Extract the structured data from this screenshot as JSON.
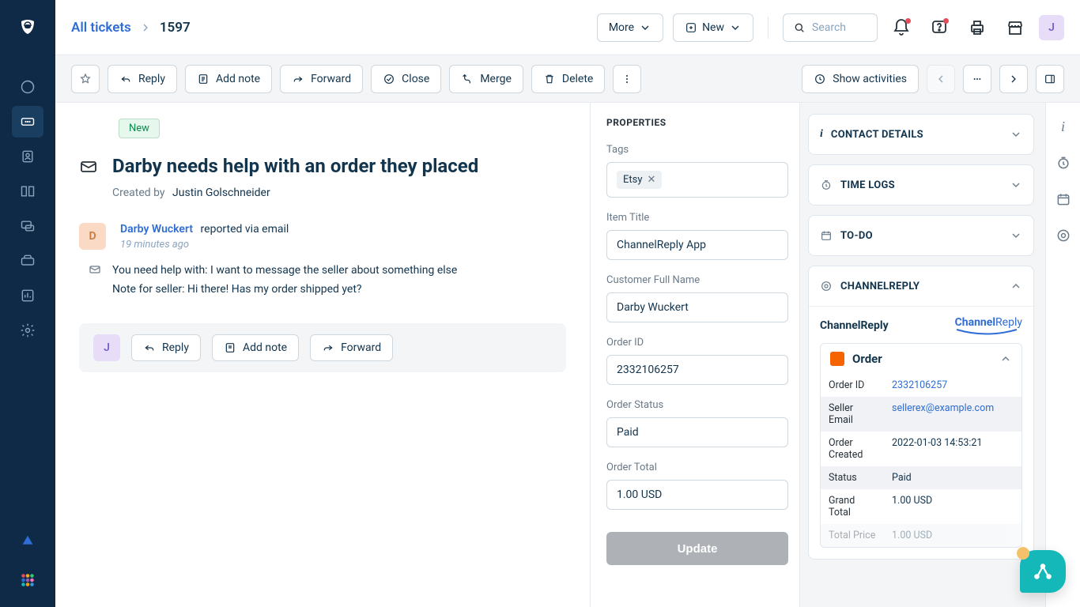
{
  "breadcrumb": {
    "link": "All tickets",
    "current": "1597"
  },
  "topbar": {
    "more": "More",
    "new": "New",
    "search_placeholder": "Search",
    "avatar_initial": "J"
  },
  "actions": {
    "reply": "Reply",
    "add_note": "Add note",
    "forward": "Forward",
    "close": "Close",
    "merge": "Merge",
    "delete": "Delete",
    "show_activities": "Show activities"
  },
  "ticket": {
    "status": "New",
    "title": "Darby needs help with an order they placed",
    "created_by_label": "Created by",
    "created_by_name": "Justin Golschneider",
    "reporter": {
      "initial": "D",
      "name": "Darby Wuckert",
      "via": "reported via email",
      "time": "19 minutes ago"
    },
    "body_line1": "You need help with: I want to message the seller about something else",
    "body_line2": "Note for seller: Hi there! Has my order shipped yet?"
  },
  "replybox": {
    "avatar_initial": "J",
    "reply": "Reply",
    "add_note": "Add note",
    "forward": "Forward"
  },
  "properties": {
    "panel_title": "PROPERTIES",
    "tags_label": "Tags",
    "tags": [
      "Etsy"
    ],
    "fields": {
      "item_title": {
        "label": "Item Title",
        "value": "ChannelReply App"
      },
      "customer_name": {
        "label": "Customer Full Name",
        "value": "Darby Wuckert"
      },
      "order_id": {
        "label": "Order ID",
        "value": "2332106257"
      },
      "order_status": {
        "label": "Order Status",
        "value": "Paid"
      },
      "order_total": {
        "label": "Order Total",
        "value": "1.00 USD"
      }
    },
    "update": "Update"
  },
  "right_panels": {
    "contact_details": "CONTACT DETAILS",
    "time_logs": "TIME LOGS",
    "todo": "TO-DO",
    "channelreply": "CHANNELREPLY"
  },
  "cr": {
    "app_name": "ChannelReply",
    "logo1": "Channel",
    "logo2": "Reply",
    "order_title": "Order",
    "rows": {
      "order_id": {
        "k": "Order ID",
        "v": "2332106257"
      },
      "seller_email": {
        "k": "Seller Email",
        "v": "sellerex@example.com"
      },
      "order_created": {
        "k": "Order Created",
        "v": "2022-01-03 14:53:21"
      },
      "status": {
        "k": "Status",
        "v": "Paid"
      },
      "grand_total": {
        "k": "Grand Total",
        "v": "1.00 USD"
      },
      "total_price": {
        "k": "Total Price",
        "v": "1.00 USD"
      }
    }
  }
}
